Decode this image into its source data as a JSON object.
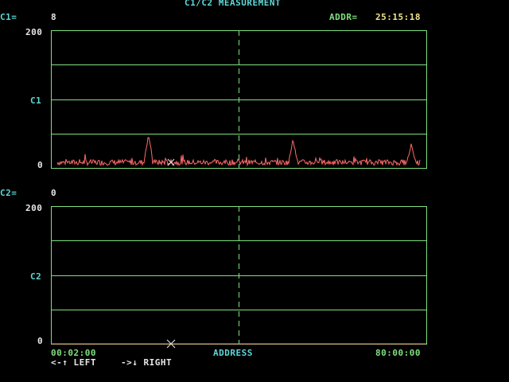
{
  "title": "C1/C2 MEASUREMENT",
  "header": {
    "c1_label": "C1=",
    "c1_value": "8",
    "addr_label": "ADDR=",
    "addr_value": "25:15:18",
    "c2_label": "C2=",
    "c2_value": "0"
  },
  "top_panel": {
    "y_max_label": "200",
    "y_mid_label": "C1",
    "y_min_label": "0"
  },
  "bottom_panel": {
    "y_max_label": "200",
    "y_mid_label": "C2",
    "y_min_label": "0"
  },
  "x_axis": {
    "start_label": "00:02:00",
    "axis_label": "ADDRESS",
    "end_label": "80:00:00"
  },
  "hints": {
    "left": "<-↑ LEFT",
    "right": "->↓ RIGHT"
  },
  "colors": {
    "grid": "#7fe07f",
    "trace": "#ff6a6a",
    "label": "#5fd7d7",
    "value": "#e8e8e8",
    "addr": "#f0e68c"
  },
  "chart_data": [
    {
      "type": "line",
      "series_label": "C1",
      "ylim": [
        0,
        200
      ],
      "x_start": "00:02:00",
      "x_end": "80:00:00",
      "grid": true,
      "baseline_noise": [
        4,
        12
      ],
      "spikes": [
        {
          "x_fraction": 0.26,
          "value": 45
        },
        {
          "x_fraction": 0.645,
          "value": 38
        },
        {
          "x_fraction": 0.96,
          "value": 32
        }
      ],
      "cursor_x_fraction": 0.5
    },
    {
      "type": "line",
      "series_label": "C2",
      "ylim": [
        0,
        200
      ],
      "x_start": "00:02:00",
      "x_end": "80:00:00",
      "grid": true,
      "values_constant": 0,
      "cursor_x_fraction": 0.5
    }
  ]
}
